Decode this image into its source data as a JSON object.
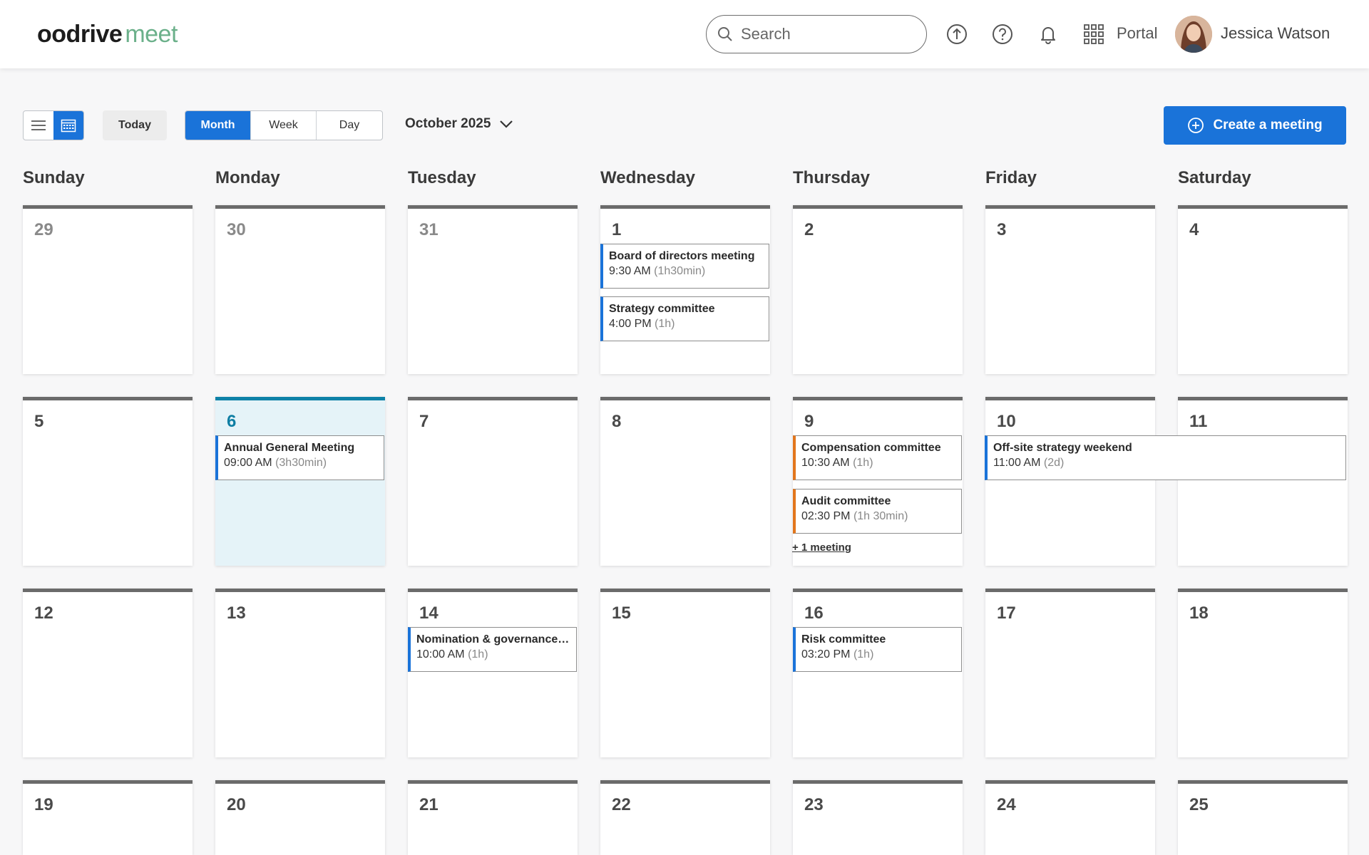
{
  "app": {
    "logo_part1": "oo",
    "logo_part2": "drive",
    "logo_part3": "meet"
  },
  "header": {
    "search_placeholder": "Search",
    "portal_label": "Portal",
    "user_name": "Jessica Watson"
  },
  "toolbar": {
    "today_label": "Today",
    "views": [
      "Month",
      "Week",
      "Day"
    ],
    "active_view": "Month",
    "current_month": "October 2025",
    "create_label": "Create a meeting"
  },
  "weekdays": [
    "Sunday",
    "Monday",
    "Tuesday",
    "Wednesday",
    "Thursday",
    "Friday",
    "Saturday"
  ],
  "weeks": [
    [
      "29",
      "30",
      "31",
      "1",
      "2",
      "3",
      "4"
    ],
    [
      "5",
      "6",
      "7",
      "8",
      "9",
      "10",
      "11"
    ],
    [
      "12",
      "13",
      "14",
      "15",
      "16",
      "17",
      "18"
    ],
    [
      "19",
      "20",
      "21",
      "22",
      "23",
      "24",
      "25"
    ]
  ],
  "events": {
    "board": {
      "title": "Board of directors meeting",
      "time": "9:30 AM",
      "duration": "(1h30min)"
    },
    "strategy": {
      "title": "Strategy committee",
      "time": "4:00 PM",
      "duration": "(1h)"
    },
    "agm": {
      "title": "Annual General Meeting",
      "time": "09:00 AM",
      "duration": "(3h30min)"
    },
    "compensation": {
      "title": "Compensation committee",
      "time": "10:30 AM",
      "duration": "(1h)"
    },
    "audit": {
      "title": "Audit committee",
      "time": "02:30 PM",
      "duration": "(1h 30min)"
    },
    "offsite": {
      "title": "Off-site strategy weekend",
      "time": "11:00 AM",
      "duration": "(2d)"
    },
    "nomination": {
      "title": "Nomination & governance committee",
      "time": "10:00 AM",
      "duration": "(1h)"
    },
    "risk": {
      "title": "Risk committee",
      "time": "03:20 PM",
      "duration": "(1h)"
    }
  },
  "more_meetings_label": "+ 1 meeting",
  "colors": {
    "accent": "#1a73d9",
    "today": "#0e82a8",
    "orange": "#e2761c",
    "logo_green": "#6bb08a"
  }
}
